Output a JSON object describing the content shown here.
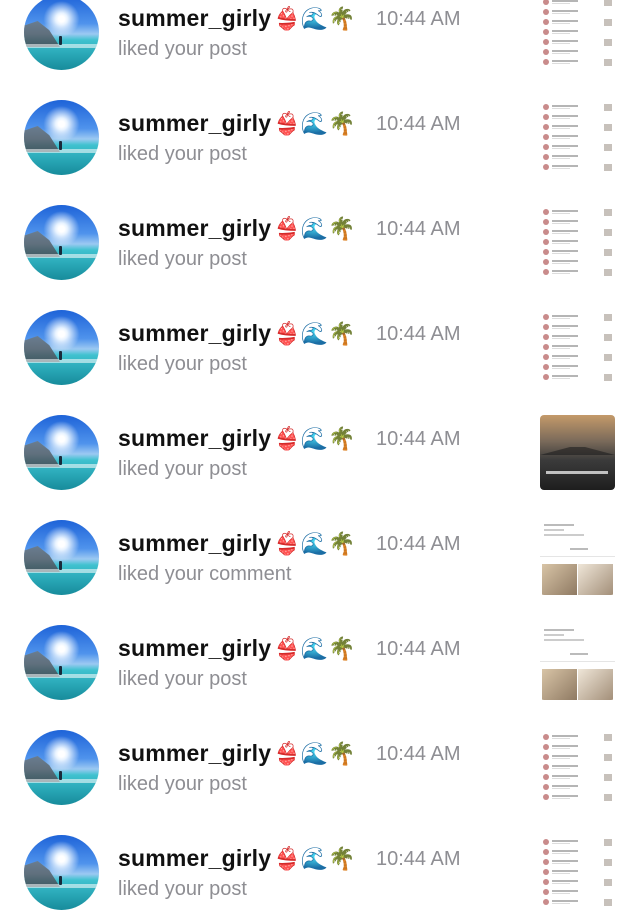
{
  "notifications": [
    {
      "username": "summer_girly",
      "emoji": "👙🌊🌴",
      "time": "10:44 AM",
      "action": "liked your post",
      "thumbnail": "list-screenshot"
    },
    {
      "username": "summer_girly",
      "emoji": "👙🌊🌴",
      "time": "10:44 AM",
      "action": "liked your post",
      "thumbnail": "list-screenshot"
    },
    {
      "username": "summer_girly",
      "emoji": "👙🌊🌴",
      "time": "10:44 AM",
      "action": "liked your post",
      "thumbnail": "list-screenshot"
    },
    {
      "username": "summer_girly",
      "emoji": "👙🌊🌴",
      "time": "10:44 AM",
      "action": "liked your post",
      "thumbnail": "list-screenshot"
    },
    {
      "username": "summer_girly",
      "emoji": "👙🌊🌴",
      "time": "10:44 AM",
      "action": "liked your post",
      "thumbnail": "dark-photo"
    },
    {
      "username": "summer_girly",
      "emoji": "👙🌊🌴",
      "time": "10:44 AM",
      "action": "liked your comment",
      "thumbnail": "profile-photos"
    },
    {
      "username": "summer_girly",
      "emoji": "👙🌊🌴",
      "time": "10:44 AM",
      "action": "liked your post",
      "thumbnail": "profile-photos"
    },
    {
      "username": "summer_girly",
      "emoji": "👙🌊🌴",
      "time": "10:44 AM",
      "action": "liked your post",
      "thumbnail": "list-screenshot"
    },
    {
      "username": "summer_girly",
      "emoji": "👙🌊🌴",
      "time": "10:44 AM",
      "action": "liked your post",
      "thumbnail": "list-screenshot"
    }
  ],
  "colors": {
    "username": "#111111",
    "secondary": "#8e8e93",
    "background": "#ffffff"
  }
}
